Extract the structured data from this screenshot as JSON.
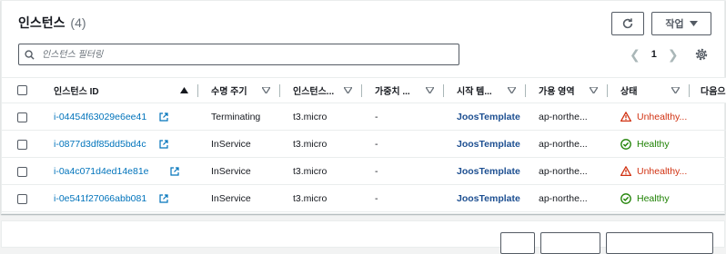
{
  "header": {
    "title": "인스턴스",
    "count": "(4)",
    "action_label": "작업"
  },
  "search": {
    "placeholder": "인스턴스 필터링"
  },
  "pagination": {
    "page": "1"
  },
  "columns": [
    "인스턴스 ID",
    "수명 주기",
    "인스턴스...",
    "가중치 ...",
    "시작 템...",
    "가용 영역",
    "상태",
    "다음으"
  ],
  "rows": [
    {
      "id": "i-04454f63029e6ee41",
      "lifecycle": "Terminating",
      "type": "t3.micro",
      "weight": "-",
      "template": "JoosTemplate",
      "az": "ap-northe...",
      "status": "Unhealthy...",
      "healthy": false
    },
    {
      "id": "i-0877d3df85dd5bd4c",
      "lifecycle": "InService",
      "type": "t3.micro",
      "weight": "-",
      "template": "JoosTemplate",
      "az": "ap-northe...",
      "status": "Healthy",
      "healthy": true
    },
    {
      "id": "i-0a4c071d4ed14e81e",
      "lifecycle": "InService",
      "type": "t3.micro",
      "weight": "-",
      "template": "JoosTemplate",
      "az": "ap-northe...",
      "status": "Unhealthy...",
      "healthy": false
    },
    {
      "id": "i-0e541f27066abb081",
      "lifecycle": "InService",
      "type": "t3.micro",
      "weight": "-",
      "template": "JoosTemplate",
      "az": "ap-northe...",
      "status": "Healthy",
      "healthy": true
    }
  ],
  "colors": {
    "link": "#0073bb",
    "healthy": "#1d8102",
    "unhealthy": "#d13212",
    "template": "#1d4f91"
  },
  "icons": [
    "refresh-icon",
    "caret-down-icon",
    "search-icon",
    "chevron-left-icon",
    "chevron-right-icon",
    "gear-icon",
    "external-link-icon",
    "warning-icon",
    "check-circle-icon",
    "sort-ascending-icon",
    "sort-icon"
  ]
}
